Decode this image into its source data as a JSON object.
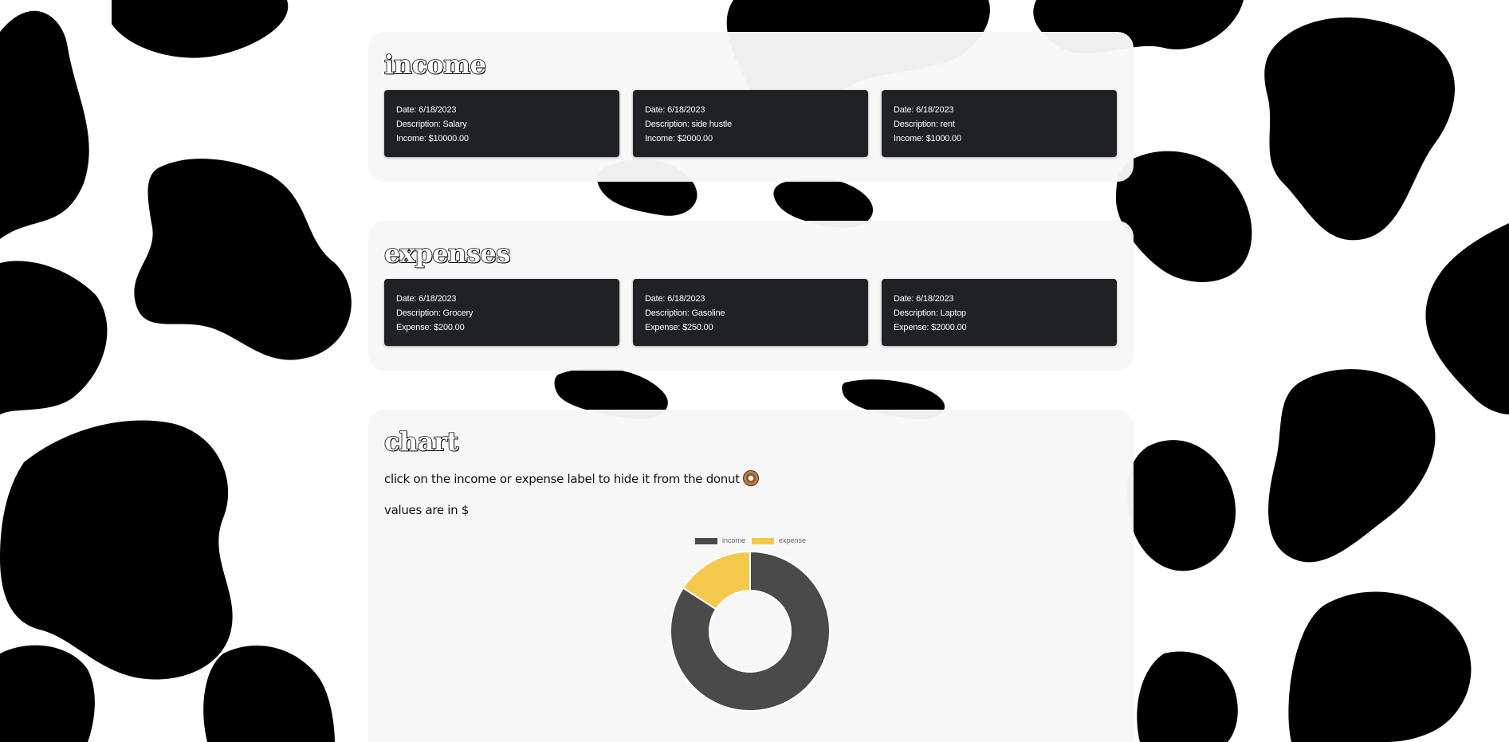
{
  "income": {
    "title": "income",
    "items": [
      {
        "date": "Date: 6/18/2023",
        "description": "Description: Salary",
        "amount": "Income: $10000.00"
      },
      {
        "date": "Date: 6/18/2023",
        "description": "Description: side hustle",
        "amount": "Income: $2000.00"
      },
      {
        "date": "Date: 6/18/2023",
        "description": "Description: rent",
        "amount": "Income: $1000.00"
      }
    ]
  },
  "expenses": {
    "title": "expenses",
    "items": [
      {
        "date": "Date: 6/18/2023",
        "description": "Description: Grocery",
        "amount": "Expense: $200.00"
      },
      {
        "date": "Date: 6/18/2023",
        "description": "Description: Gasoline",
        "amount": "Expense: $250.00"
      },
      {
        "date": "Date: 6/18/2023",
        "description": "Description: Laptop",
        "amount": "Expense: $2000.00"
      }
    ]
  },
  "chart": {
    "title": "chart",
    "hint": "click on the income or expense label to hide it from the donut",
    "units": "values are in $"
  },
  "colors": {
    "income": "#4a4a4a",
    "expense": "#f4c84a",
    "card_bg": "#202124"
  },
  "chart_data": {
    "type": "pie",
    "variant": "donut",
    "categories": [
      "income",
      "expense"
    ],
    "values": [
      13000,
      2450
    ],
    "legend_position": "top"
  }
}
